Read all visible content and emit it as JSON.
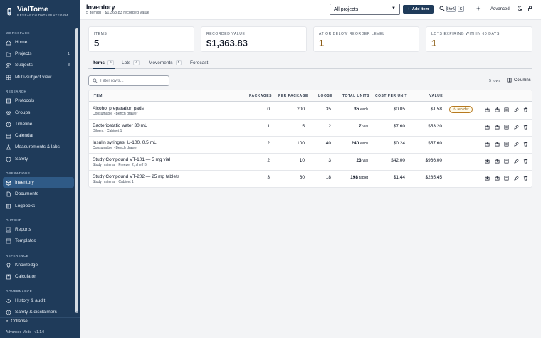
{
  "brand": {
    "title": "VialTome",
    "subtitle": "RESEARCH DATA PLATFORM"
  },
  "sidebar": {
    "sections": [
      {
        "label": "WORKSPACE"
      },
      {
        "label": "RESEARCH"
      },
      {
        "label": "OPERATIONS"
      },
      {
        "label": "OUTPUT"
      },
      {
        "label": "REFERENCE"
      },
      {
        "label": "GOVERNANCE"
      }
    ],
    "items": [
      {
        "label": "Home",
        "icon": "home-icon"
      },
      {
        "label": "Projects",
        "icon": "folder-icon",
        "count": "1"
      },
      {
        "label": "Subjects",
        "icon": "users-icon",
        "count": "8"
      },
      {
        "label": "Multi-subject view",
        "icon": "grid-icon"
      },
      {
        "label": "Protocols",
        "icon": "document-icon"
      },
      {
        "label": "Groups",
        "icon": "group-icon"
      },
      {
        "label": "Timeline",
        "icon": "clock-icon"
      },
      {
        "label": "Calendar",
        "icon": "calendar-icon"
      },
      {
        "label": "Measurements & labs",
        "icon": "flask-icon"
      },
      {
        "label": "Safety",
        "icon": "shield-icon"
      },
      {
        "label": "Inventory",
        "icon": "box-icon",
        "active": true
      },
      {
        "label": "Documents",
        "icon": "file-icon"
      },
      {
        "label": "Logbooks",
        "icon": "book-icon"
      },
      {
        "label": "Reports",
        "icon": "chart-icon"
      },
      {
        "label": "Templates",
        "icon": "template-icon"
      },
      {
        "label": "Knowledge",
        "icon": "lightbulb-icon"
      },
      {
        "label": "Calculator",
        "icon": "calculator-icon"
      },
      {
        "label": "History & audit",
        "icon": "history-icon"
      },
      {
        "label": "Safety & disclaimers",
        "icon": "info-icon"
      }
    ],
    "collapse_label": "Collapse",
    "mode_label": "Advanced Mode · v1.1.0"
  },
  "topbar": {
    "title": "Inventory",
    "subtitle": "5 item(s) · $1,363.83 recorded value",
    "project_select": "All projects",
    "add_label": "Add item",
    "kbd_ctrl": "Ctrl",
    "kbd_k": "K",
    "advanced_label": "Advanced"
  },
  "stats": [
    {
      "label": "ITEMS",
      "value": "5"
    },
    {
      "label": "RECORDED VALUE",
      "value": "$1,363.83"
    },
    {
      "label": "AT OR BELOW REORDER LEVEL",
      "value": "1"
    },
    {
      "label": "LOTS EXPIRING WITHIN 60 DAYS",
      "value": "1"
    }
  ],
  "tabs": [
    {
      "label": "Items",
      "badge": "5",
      "active": true
    },
    {
      "label": "Lots",
      "badge": "4"
    },
    {
      "label": "Movements",
      "badge": "5"
    },
    {
      "label": "Forecast"
    }
  ],
  "filter": {
    "placeholder": "Filter rows..."
  },
  "rows_count": "5 rows",
  "columns_label": "Columns",
  "table": {
    "headers": [
      "ITEM",
      "PACKAGES",
      "PER PACKAGE",
      "LOOSE",
      "TOTAL UNITS",
      "COST PER UNIT",
      "VALUE"
    ],
    "rows": [
      {
        "name": "Alcohol preparation pads",
        "sub": "Consumable · Bench drawer",
        "packages": "0",
        "per_package": "200",
        "loose": "35",
        "total": "35",
        "unit": "each",
        "cost": "$0.05",
        "value": "$1.58",
        "reorder": "reorder"
      },
      {
        "name": "Bacteriostatic water 30 mL",
        "sub": "Diluent · Cabinet 1",
        "packages": "1",
        "per_package": "5",
        "loose": "2",
        "total": "7",
        "unit": "vial",
        "cost": "$7.60",
        "value": "$53.20"
      },
      {
        "name": "Insulin syringes, U-100, 0.5 mL",
        "sub": "Consumable · Bench drawer",
        "packages": "2",
        "per_package": "100",
        "loose": "40",
        "total": "240",
        "unit": "each",
        "cost": "$0.24",
        "value": "$57.60"
      },
      {
        "name": "Study Compound VT-101 — 5 mg vial",
        "sub": "Study material · Freezer 2, shelf B",
        "packages": "2",
        "per_package": "10",
        "loose": "3",
        "total": "23",
        "unit": "vial",
        "cost": "$42.00",
        "value": "$966.00"
      },
      {
        "name": "Study Compound VT-202 — 25 mg tablets",
        "sub": "Study material · Cabinet 1",
        "packages": "3",
        "per_package": "60",
        "loose": "18",
        "total": "198",
        "unit": "tablet",
        "cost": "$1.44",
        "value": "$285.45"
      }
    ]
  },
  "colors": {
    "sidebar": "#1f3b5a",
    "accent": "#1f3b5a",
    "warn": "#8a5a12"
  }
}
